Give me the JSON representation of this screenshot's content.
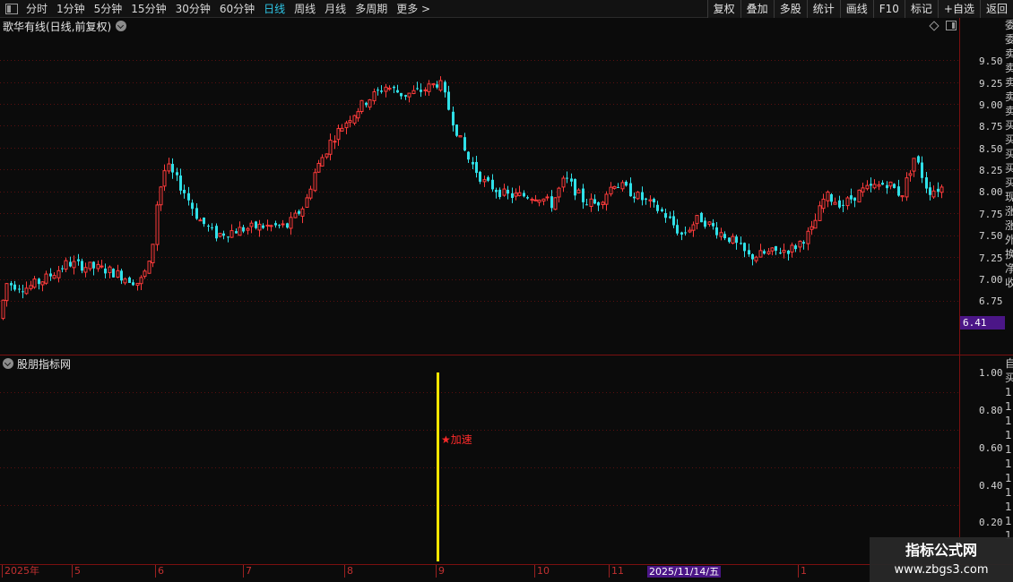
{
  "toolbar": {
    "periods": [
      "分时",
      "1分钟",
      "5分钟",
      "15分钟",
      "30分钟",
      "60分钟",
      "日线",
      "周线",
      "月线",
      "多周期",
      "更多 >"
    ],
    "active_period": "日线",
    "tools": [
      "复权",
      "叠加",
      "多股",
      "统计",
      "画线",
      "F10",
      "标记",
      "+自选",
      "返回"
    ]
  },
  "main_chart": {
    "title": "歌华有线(日线,前复权)",
    "price_labels": [
      "9.50",
      "9.25",
      "9.00",
      "8.75",
      "8.50",
      "8.25",
      "8.00",
      "7.75",
      "7.50",
      "7.25",
      "7.00",
      "6.75"
    ],
    "current_price": "6.41",
    "up_color": "#ff3b3b",
    "down_color": "#2fe0e8",
    "grid_color": "#5a0f0f"
  },
  "side_panel": {
    "chars": [
      "委",
      "委",
      "卖",
      "卖",
      "卖",
      "卖",
      "卖",
      "买",
      "买",
      "买",
      "买",
      "买",
      "现",
      "涨",
      "涨",
      "外",
      "换",
      "净",
      "收"
    ]
  },
  "sub_chart": {
    "title": "股朋指标网",
    "labels": [
      "1.00",
      "0.80",
      "0.60",
      "0.40",
      "0.20"
    ],
    "signal_label": "★加速",
    "signal_value": 1.0,
    "signal_color": "#ffe600",
    "side_chars": [
      "自",
      "买",
      "1",
      "1",
      "1",
      "1",
      "1",
      "1",
      "1",
      "1",
      "1",
      "1",
      "1"
    ]
  },
  "date_axis": {
    "ticks": [
      {
        "label": "2025年"
      },
      {
        "label": "5"
      },
      {
        "label": "6"
      },
      {
        "label": "7"
      },
      {
        "label": "8"
      },
      {
        "label": "9"
      },
      {
        "label": "10"
      },
      {
        "label": "11"
      },
      {
        "label": "1"
      }
    ],
    "highlight": "2025/11/14/五"
  },
  "watermark": {
    "line1": "指标公式网",
    "line2": "www.zbgs3.com"
  }
}
